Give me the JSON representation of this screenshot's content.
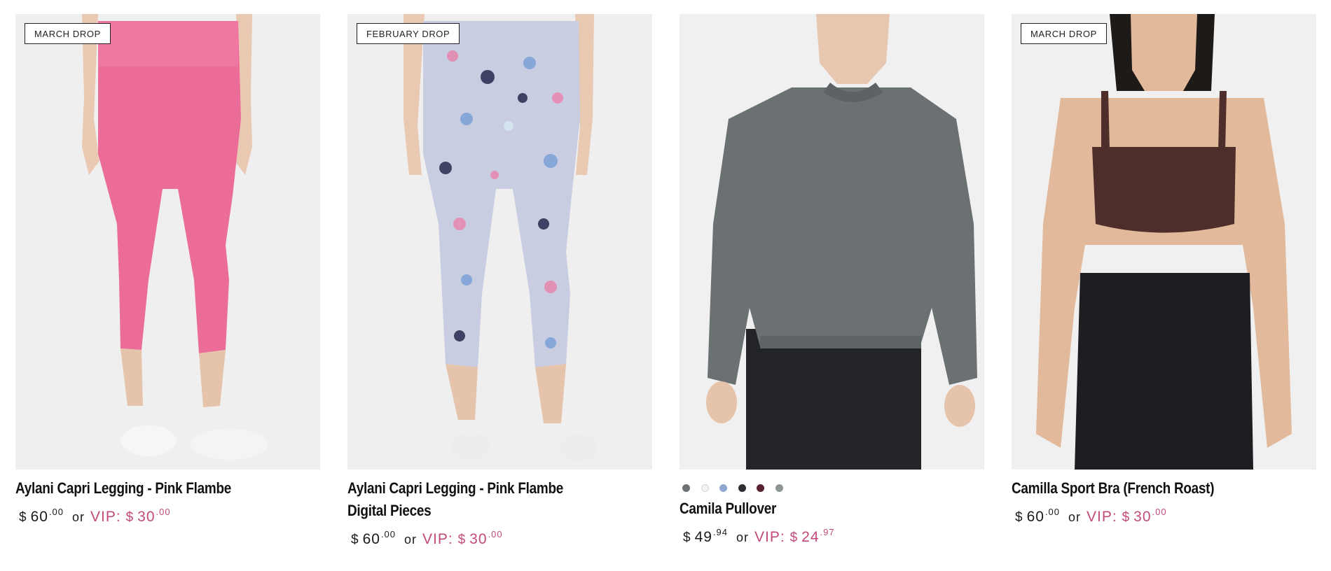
{
  "colors": {
    "accent_vip": "#c24a7a",
    "image_bg": "#f1f1f1",
    "text": "#111111"
  },
  "products": [
    {
      "badge": "MARCH DROP",
      "name": "Aylani Capri Legging - Pink Flambe",
      "price": {
        "currency": "$",
        "whole": "60",
        "cents": ".00"
      },
      "or": "or",
      "vip": {
        "label": "VIP:",
        "currency": "$",
        "whole": "30",
        "cents": ".00"
      },
      "image": "pink-legging-photo"
    },
    {
      "badge": "FEBRUARY DROP",
      "name": "Aylani Capri Legging - Pink Flambe Digital Pieces",
      "price": {
        "currency": "$",
        "whole": "60",
        "cents": ".00"
      },
      "or": "or",
      "vip": {
        "label": "VIP:",
        "currency": "$",
        "whole": "30",
        "cents": ".00"
      },
      "image": "printed-legging-photo"
    },
    {
      "badge": "",
      "name": "Camila Pullover",
      "swatches": [
        "#6d7174",
        "#f3f3f3",
        "#8fa8cf",
        "#2d2f33",
        "#5a2230",
        "#8d9690"
      ],
      "price": {
        "currency": "$",
        "whole": "49",
        "cents": ".94"
      },
      "or": "or",
      "vip": {
        "label": "VIP:",
        "currency": "$",
        "whole": "24",
        "cents": ".97"
      },
      "image": "gray-pullover-photo"
    },
    {
      "badge": "MARCH DROP",
      "name": "Camilla Sport Bra (French Roast)",
      "price": {
        "currency": "$",
        "whole": "60",
        "cents": ".00"
      },
      "or": "or",
      "vip": {
        "label": "VIP:",
        "currency": "$",
        "whole": "30",
        "cents": ".00"
      },
      "image": "sport-bra-photo"
    }
  ]
}
